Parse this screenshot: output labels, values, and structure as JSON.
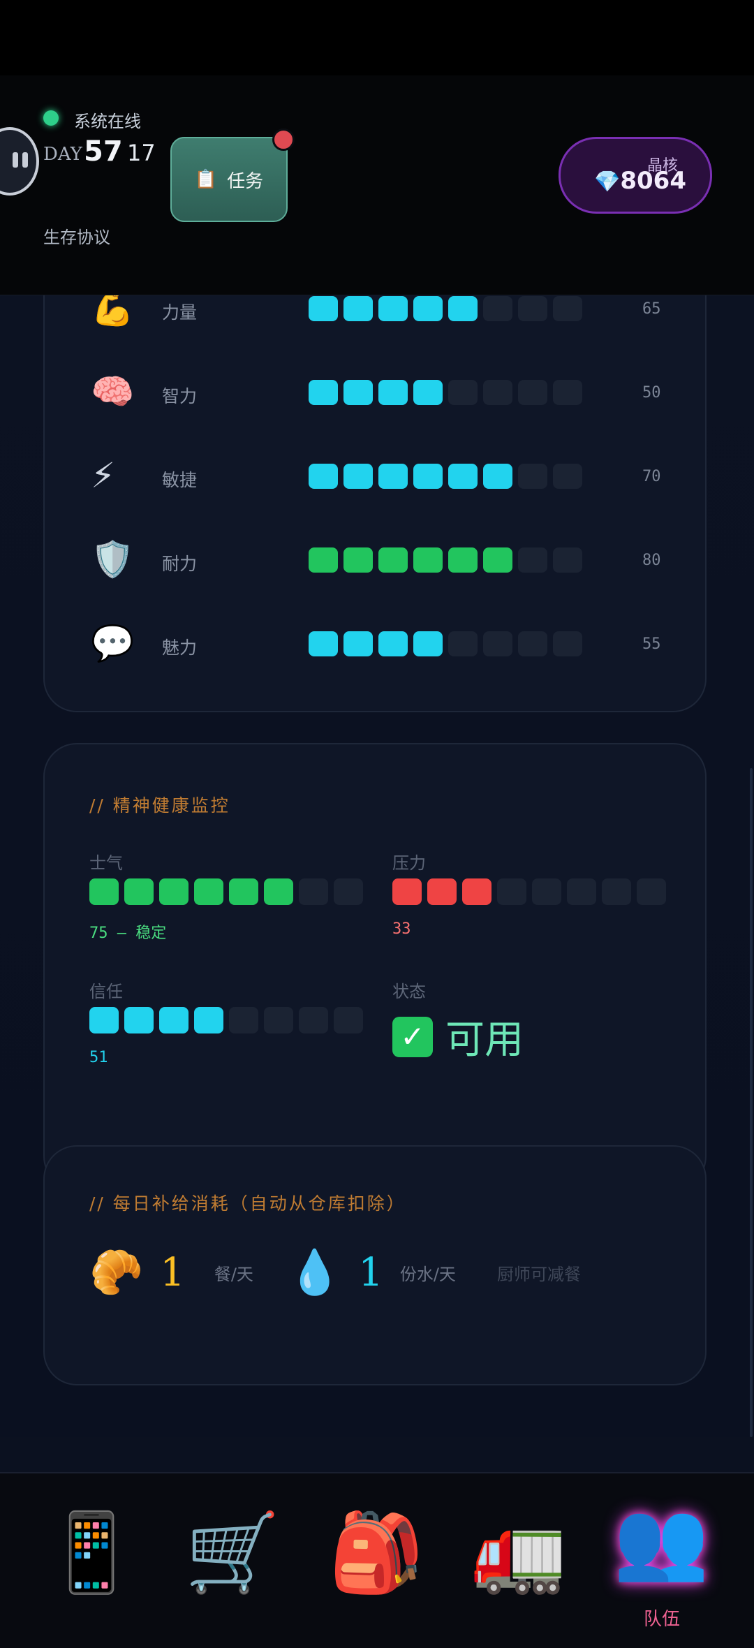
{
  "header": {
    "online_text": "系统在线",
    "day_label": "DAY",
    "day_number": "57",
    "day_sub": "17",
    "protocol": "生存协议",
    "task_icon": "📋",
    "task_label": "任务",
    "crystal_label": "晶核",
    "crystal_icon": "💎",
    "crystal_value": "8064"
  },
  "stats": [
    {
      "icon": "💪",
      "name": "力量",
      "value": "65",
      "filled": 5,
      "total": 8,
      "color": "cyan"
    },
    {
      "icon": "🧠",
      "name": "智力",
      "value": "50",
      "filled": 4,
      "total": 8,
      "color": "cyan"
    },
    {
      "icon": "⚡",
      "name": "敏捷",
      "value": "70",
      "filled": 6,
      "total": 8,
      "color": "cyan"
    },
    {
      "icon": "🛡️",
      "name": "耐力",
      "value": "80",
      "filled": 6,
      "total": 8,
      "color": "green"
    },
    {
      "icon": "💬",
      "name": "魅力",
      "value": "55",
      "filled": 4,
      "total": 8,
      "color": "cyan"
    }
  ],
  "mental": {
    "title": "//  精神健康监控",
    "morale": {
      "label": "士气",
      "value_text": "75 — 稳定",
      "filled": 6,
      "total": 8,
      "color": "green"
    },
    "pressure": {
      "label": "压力",
      "value_text": "33",
      "filled": 3,
      "total": 8,
      "color": "red"
    },
    "trust": {
      "label": "信任",
      "value_text": "51",
      "filled": 4,
      "total": 8,
      "color": "cyan"
    },
    "status": {
      "label": "状态",
      "check": "✓",
      "value": "可用"
    }
  },
  "supply": {
    "title": "//  每日补给消耗（自动从仓库扣除）",
    "food_icon": "🥐",
    "food_count": "1",
    "food_unit": "餐/天",
    "water_icon": "💧",
    "water_count": "1",
    "water_unit": "份水/天",
    "note": "厨师可减餐"
  },
  "nav": {
    "items": [
      {
        "icon": "📱",
        "name": "phone"
      },
      {
        "icon": "🛒",
        "name": "shop"
      },
      {
        "icon": "🎒",
        "name": "backpack"
      },
      {
        "icon": "🚛",
        "name": "truck"
      },
      {
        "icon": "👥",
        "name": "team"
      }
    ],
    "active_label": "队伍"
  },
  "colors": {
    "cyan": "#22d3ee",
    "green": "#22c55e",
    "red": "#ef4444",
    "accent_orange": "#c07c32"
  }
}
